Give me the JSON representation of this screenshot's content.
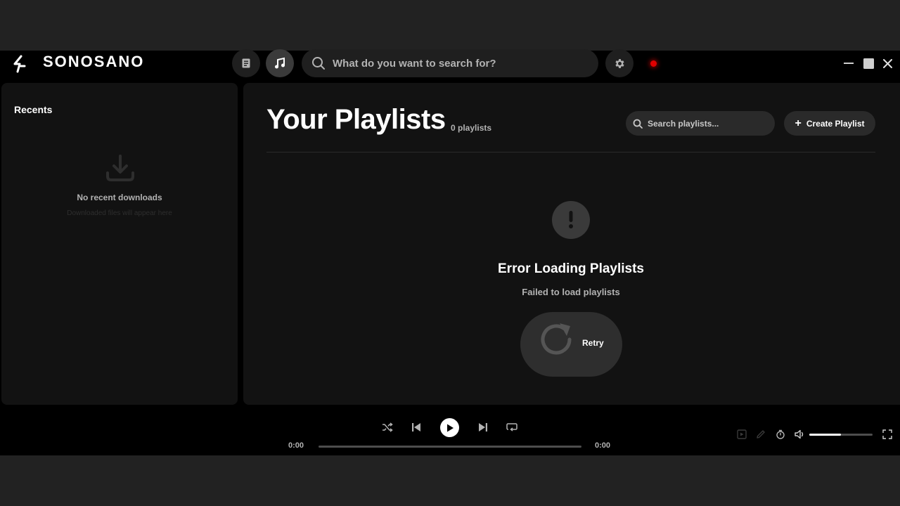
{
  "app": {
    "brand": "SONOSANO",
    "search_placeholder": "What do you want to search for?"
  },
  "sidebar": {
    "title": "Recents",
    "empty_title": "No recent downloads",
    "empty_subtitle": "Downloaded files will appear here"
  },
  "main": {
    "title": "Your Playlists",
    "count": "0 playlists",
    "search_placeholder": "Search playlists...",
    "create_label": "Create Playlist",
    "error_title": "Error Loading Playlists",
    "error_message": "Failed to load playlists",
    "retry_label": "Retry"
  },
  "player": {
    "current_time": "0:00",
    "total_time": "0:00",
    "progress": 0,
    "volume": 0.5
  },
  "colors": {
    "background": "#000000",
    "panel": "#121212",
    "recording_dot": "#e00000"
  },
  "icons": [
    "logo-icon",
    "library-icon",
    "music-note-icon",
    "search-icon",
    "gear-icon",
    "minimize-icon",
    "maximize-icon",
    "close-icon",
    "download-icon",
    "plus-icon",
    "exclamation-icon",
    "refresh-icon",
    "shuffle-icon",
    "previous-icon",
    "play-icon",
    "next-icon",
    "repeat-icon",
    "queue-icon",
    "edit-icon",
    "timer-icon",
    "volume-icon",
    "fullscreen-icon"
  ]
}
